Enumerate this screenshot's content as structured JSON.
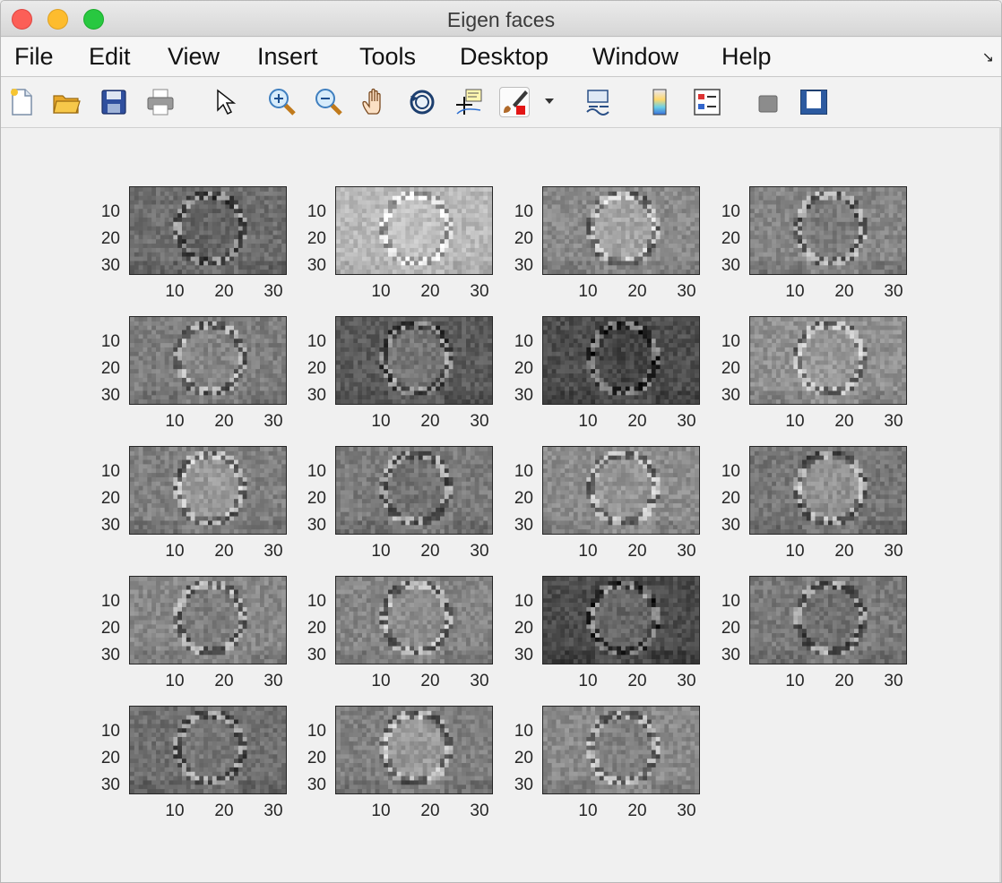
{
  "window": {
    "title": "Eigen faces"
  },
  "menubar": {
    "items": [
      "File",
      "Edit",
      "View",
      "Insert",
      "Tools",
      "Desktop",
      "Window",
      "Help"
    ],
    "corner_icon": "dock-arrow-icon"
  },
  "toolbar": {
    "icons": [
      "new-figure-icon",
      "open-file-icon",
      "save-icon",
      "print-icon",
      "pointer-icon",
      "zoom-in-icon",
      "zoom-out-icon",
      "pan-hand-icon",
      "rotate-3d-icon",
      "data-cursor-icon",
      "brush-icon",
      "link-plot-icon",
      "colorbar-icon",
      "legend-icon",
      "hide-plot-tools-icon",
      "show-plot-tools-icon"
    ]
  },
  "figure": {
    "subplot_count": 19,
    "columns": 4,
    "y_ticks": [
      "10",
      "20",
      "30"
    ],
    "x_ticks": [
      "10",
      "20",
      "30"
    ],
    "colormap": "gray",
    "face_tones": [
      "#6f6f6f",
      "#b9b9b9",
      "#8a8a8a",
      "#858585",
      "#7e7e7e",
      "#5b5b5b",
      "#4e4e4e",
      "#909090",
      "#808080",
      "#7c7c7c",
      "#8d8d8d",
      "#777777",
      "#888888",
      "#858585",
      "#4c4c4c",
      "#7a7a7a",
      "#707070",
      "#7f7f7f",
      "#8a8a8a"
    ]
  }
}
